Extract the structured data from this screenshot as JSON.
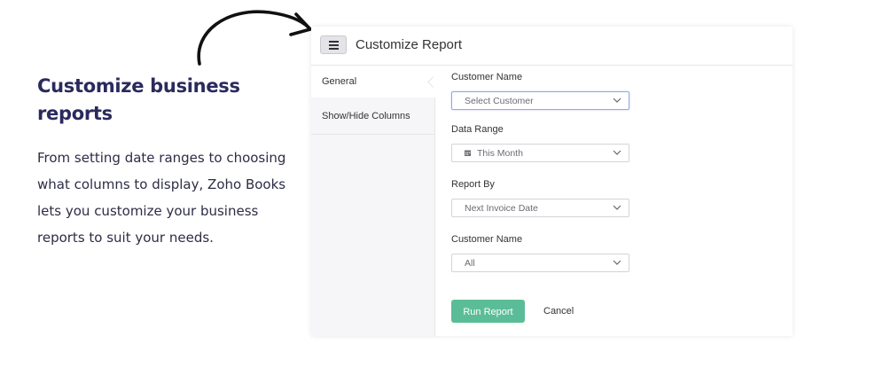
{
  "promo": {
    "title": "Customize business reports",
    "body": "From setting date ranges to choosing what columns to display, Zoho Books lets you customize your business reports to suit your needs."
  },
  "header": {
    "menu_icon": "hamburger-menu-icon",
    "title": "Customize Report"
  },
  "sidebar": {
    "items": [
      {
        "label": "General",
        "active": true
      },
      {
        "label": "Show/Hide Columns",
        "active": false
      }
    ]
  },
  "form": {
    "fields": [
      {
        "label": "Customer Name",
        "value": "Select Customer"
      },
      {
        "label": "Data Range",
        "value": "This Month",
        "icon": "calendar-icon"
      },
      {
        "label": "Report By",
        "value": "Next Invoice Date"
      },
      {
        "label": "Customer Name",
        "value": "All"
      }
    ],
    "run_label": "Run Report",
    "cancel_label": "Cancel"
  },
  "colors": {
    "accent": "#5bbd97",
    "heading": "#2a2a5e",
    "focus": "#8fa8e6"
  }
}
